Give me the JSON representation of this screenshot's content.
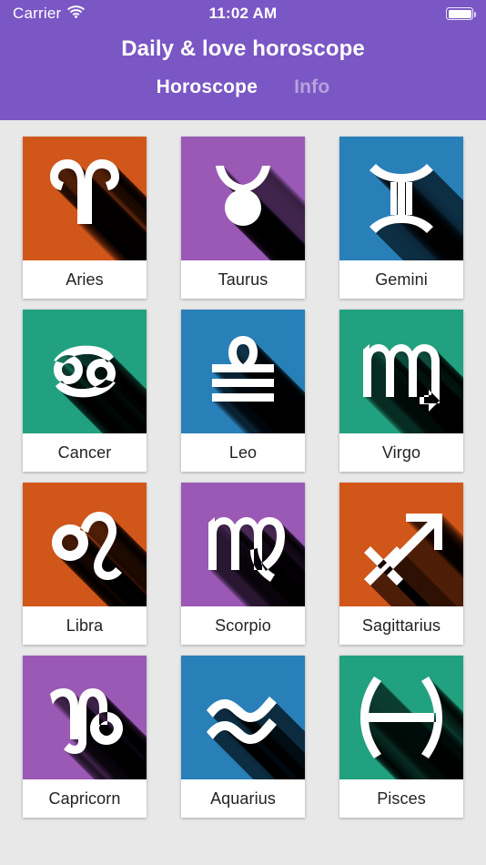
{
  "status_bar": {
    "carrier": "Carrier",
    "wifi_icon": "wifi-icon",
    "time": "11:02 AM",
    "battery_icon": "battery-full-icon"
  },
  "header": {
    "title": "Daily & love horoscope",
    "background_color": "#7a57c4",
    "tabs": [
      {
        "label": "Horoscope",
        "active": true
      },
      {
        "label": "Info",
        "active": false
      }
    ]
  },
  "content": {
    "background_color": "#e8e8e8",
    "columns": 3,
    "rows": 4
  },
  "palette": {
    "orange": "#d1561a",
    "purple": "#9b59b6",
    "blue": "#2980b9",
    "green": "#22a180",
    "glyph": "#ffffff",
    "card_background": "#ffffff",
    "label_text": "#232323"
  },
  "signs": [
    {
      "label": "Aries",
      "color": "#d1561a",
      "glyph": "aries-ram-horns-icon"
    },
    {
      "label": "Taurus",
      "color": "#9b59b6",
      "glyph": "taurus-bull-icon"
    },
    {
      "label": "Gemini",
      "color": "#2980b9",
      "glyph": "gemini-twins-icon"
    },
    {
      "label": "Cancer",
      "color": "#22a180",
      "glyph": "cancer-crab-icon"
    },
    {
      "label": "Leo",
      "color": "#2980b9",
      "glyph": "libra-scales-icon"
    },
    {
      "label": "Virgo",
      "color": "#22a180",
      "glyph": "scorpio-scorpion-icon"
    },
    {
      "label": "Libra",
      "color": "#d1561a",
      "glyph": "leo-lion-icon"
    },
    {
      "label": "Scorpio",
      "color": "#9b59b6",
      "glyph": "virgo-maiden-icon"
    },
    {
      "label": "Sagittarius",
      "color": "#d1561a",
      "glyph": "sagittarius-arrow-icon"
    },
    {
      "label": "Capricorn",
      "color": "#9b59b6",
      "glyph": "capricorn-goat-icon"
    },
    {
      "label": "Aquarius",
      "color": "#2980b9",
      "glyph": "aquarius-waves-icon"
    },
    {
      "label": "Pisces",
      "color": "#22a180",
      "glyph": "pisces-fish-icon"
    }
  ]
}
